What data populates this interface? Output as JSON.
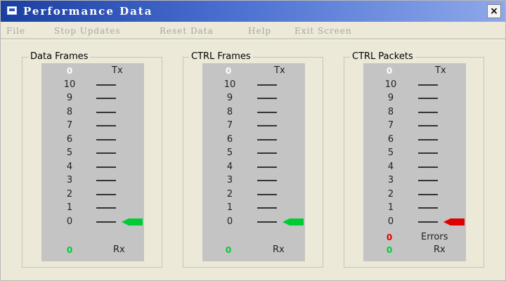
{
  "window": {
    "title": "Performance Data",
    "close_label": "×"
  },
  "menu": {
    "items": [
      "File",
      "Stop Updates",
      "Reset Data",
      "Help",
      "Exit Screen"
    ]
  },
  "scale_ticks": [
    "10",
    "9",
    "8",
    "7",
    "6",
    "5",
    "4",
    "3",
    "2",
    "1",
    "0"
  ],
  "groups": [
    {
      "label": "Data Frames",
      "tx_label": "Tx",
      "rx_label": "Rx",
      "tx_value": "0",
      "rx_value": "0",
      "level_indicator": "0",
      "indicator_color": "#00cc33"
    },
    {
      "label": "CTRL Frames",
      "tx_label": "Tx",
      "rx_label": "Rx",
      "tx_value": "0",
      "rx_value": "0",
      "level_indicator": "0",
      "indicator_color": "#00cc33"
    },
    {
      "label": "CTRL Packets",
      "tx_label": "Tx",
      "rx_label": "Rx",
      "errors_label": "Errors",
      "tx_value": "0",
      "rx_value": "0",
      "errors_value": "0",
      "level_indicator": "0",
      "indicator_color": "#e00000"
    }
  ],
  "colors": {
    "titlebar": "#1a3fa0",
    "indicator_green": "#00cc33",
    "indicator_red": "#e00000",
    "value_white": "#ffffff",
    "value_green": "#00cc33",
    "value_red": "#e00000"
  }
}
